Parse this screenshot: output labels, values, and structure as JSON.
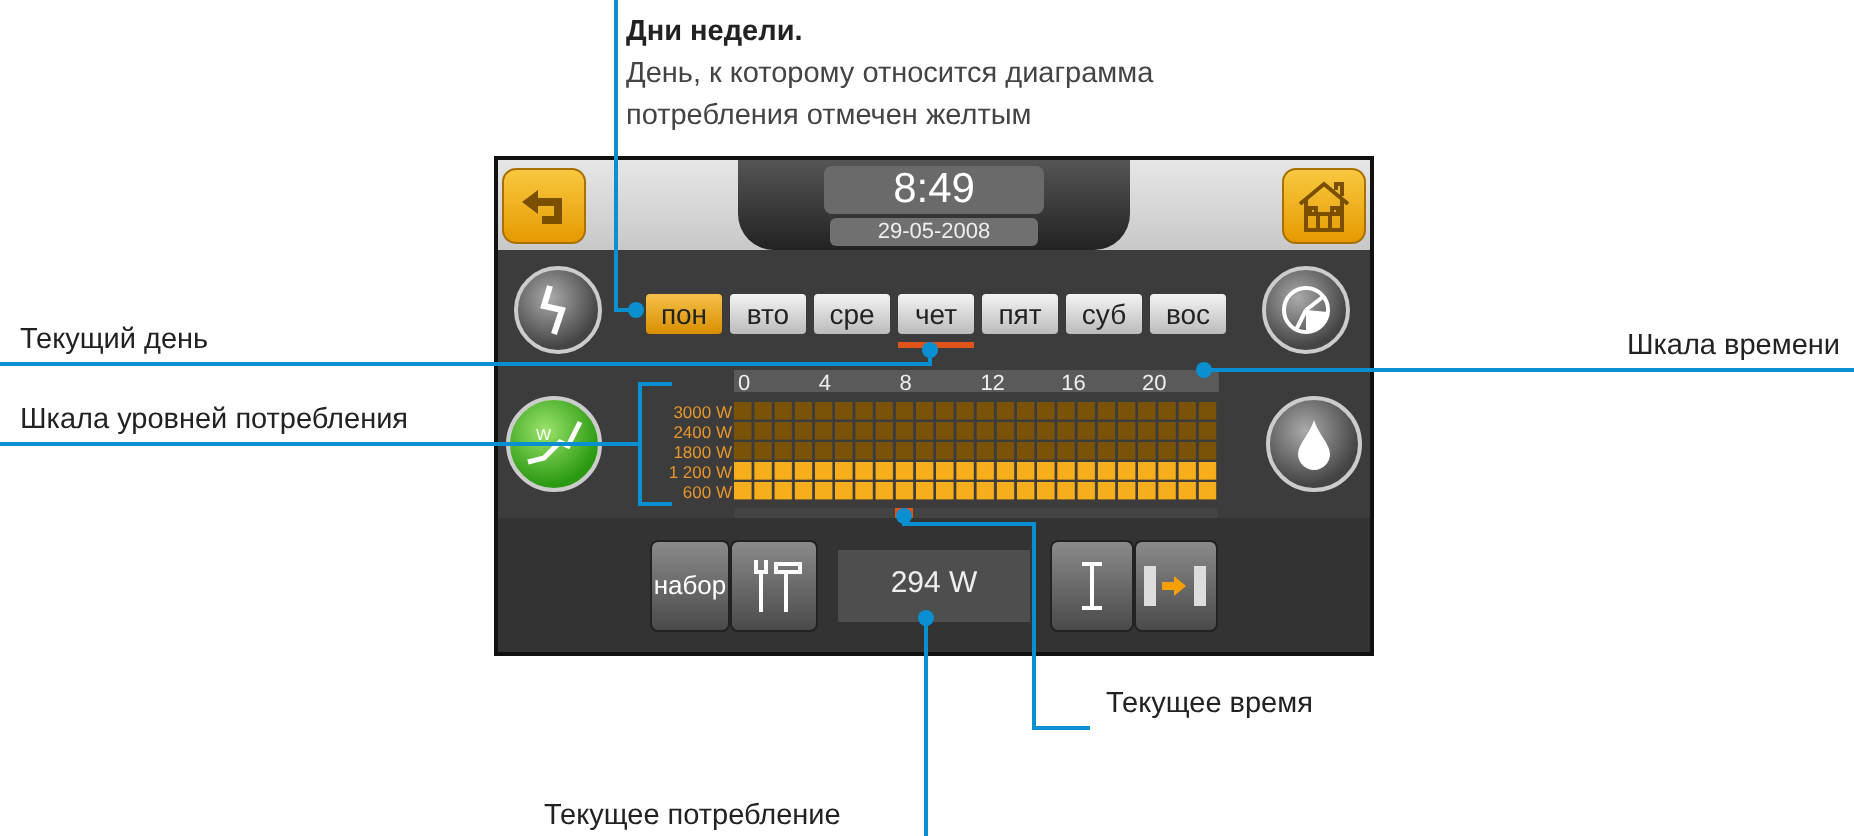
{
  "annotations": [
    {
      "kind": "heading",
      "title": "Дни недели.",
      "text": "День, к которому относится диаграмма потребления отмечен желтым"
    },
    {
      "kind": "left",
      "text": "Текущий день"
    },
    {
      "kind": "right",
      "text": "Шкала времени"
    },
    {
      "kind": "left",
      "text": "Шкала уровней потребления"
    },
    {
      "kind": "below",
      "text": "Текущее время"
    },
    {
      "kind": "below",
      "text": "Текущее потребление"
    }
  ],
  "device": {
    "clock": {
      "time": "8:49",
      "date": "29-05-2008"
    },
    "days": [
      {
        "label": "пон",
        "selected": true,
        "current": false
      },
      {
        "label": "вто",
        "selected": false,
        "current": false
      },
      {
        "label": "сре",
        "selected": false,
        "current": false
      },
      {
        "label": "чет",
        "selected": false,
        "current": true
      },
      {
        "label": "пят",
        "selected": false,
        "current": false
      },
      {
        "label": "суб",
        "selected": false,
        "current": false
      },
      {
        "label": "вос",
        "selected": false,
        "current": false
      }
    ],
    "consumption_button_label": "W",
    "time_scale": [
      "0",
      "4",
      "8",
      "12",
      "16",
      "20"
    ],
    "level_scale": [
      "3000 W",
      "2400 W",
      "1800 W",
      "1 200 W",
      "600 W"
    ],
    "hour_meters": [
      {
        "level": 0.4
      },
      {
        "level": 0.4
      },
      {
        "level": 0.4
      },
      {
        "level": 0.4
      },
      {
        "level": 0.4
      },
      {
        "level": 0.4
      },
      {
        "level": 0.4
      },
      {
        "level": 0.4
      },
      {
        "level": 0.4
      },
      {
        "level": 0.4
      },
      {
        "level": 0.4
      },
      {
        "level": 0.4
      },
      {
        "level": 0.4
      },
      {
        "level": 0.4
      },
      {
        "level": 0.4
      },
      {
        "level": 0.4
      },
      {
        "level": 0.4
      },
      {
        "level": 0.4
      },
      {
        "level": 0.4
      },
      {
        "level": 0.4
      },
      {
        "level": 0.4
      },
      {
        "level": 0.4
      },
      {
        "level": 0.4
      },
      {
        "level": 0.4
      }
    ],
    "time_marker": {
      "level": 0.35
    },
    "preset_button": "набор",
    "current_consumption": "294 W"
  }
}
